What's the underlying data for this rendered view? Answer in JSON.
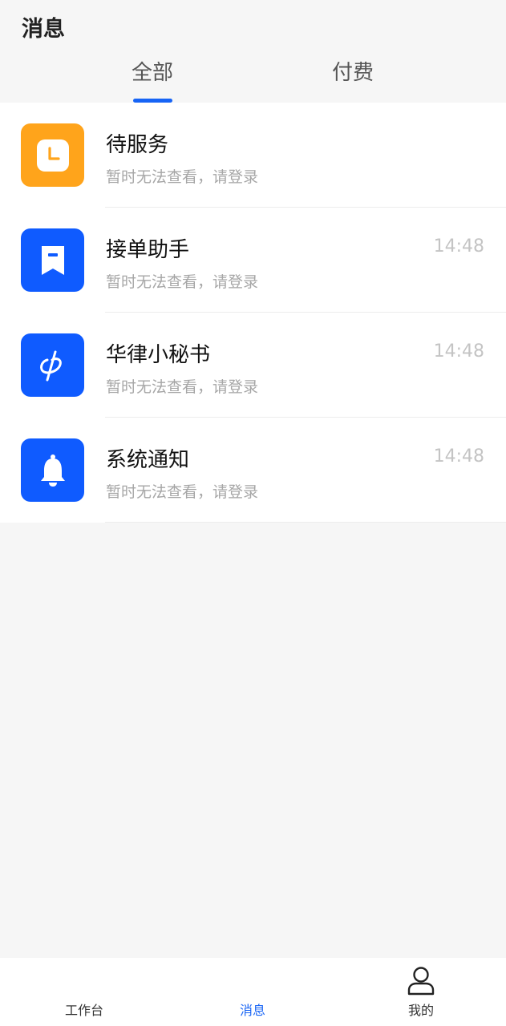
{
  "header": {
    "title": "消息",
    "tabs": [
      {
        "label": "全部",
        "active": true
      },
      {
        "label": "付费",
        "active": false
      }
    ]
  },
  "messages": [
    {
      "title": "待服务",
      "subtitle": "暂时无法查看，请登录",
      "time": "",
      "icon": "clock-icon",
      "color": "#ffa41b"
    },
    {
      "title": "接单助手",
      "subtitle": "暂时无法查看，请登录",
      "time": "14:48",
      "icon": "bookmark-icon",
      "color": "#0f5bff"
    },
    {
      "title": "华律小秘书",
      "subtitle": "暂时无法查看，请登录",
      "time": "14:48",
      "icon": "phi-logo-icon",
      "color": "#0f5bff"
    },
    {
      "title": "系统通知",
      "subtitle": "暂时无法查看，请登录",
      "time": "14:48",
      "icon": "bell-icon",
      "color": "#0f5bff"
    }
  ],
  "tabbar": {
    "items": [
      {
        "label": "工作台",
        "active": false
      },
      {
        "label": "消息",
        "active": true
      },
      {
        "label": "我的",
        "active": false,
        "icon": "person-icon"
      }
    ]
  },
  "colors": {
    "accent": "#1764f5",
    "background": "#f6f6f6"
  }
}
